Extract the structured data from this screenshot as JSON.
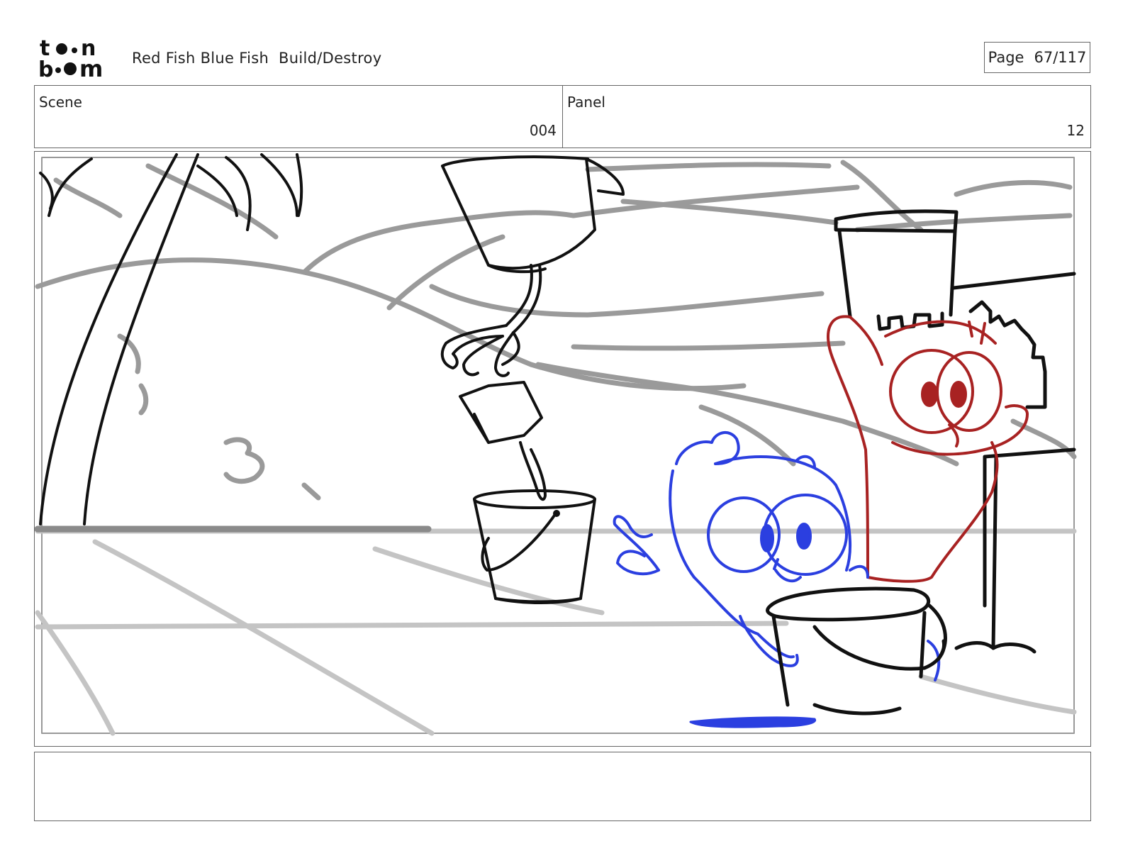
{
  "header": {
    "logo_text": "toon boom",
    "title": "Red Fish Blue Fish  Build/Destroy",
    "page_label": "Page",
    "page_value": "67/117"
  },
  "info": {
    "scene_label": "Scene",
    "scene_value": "004",
    "panel_label": "Panel",
    "panel_value": "12"
  },
  "sketch": {
    "description_icons": [
      "palm-tree",
      "hanging-bucket",
      "grabber-claw",
      "sand-bucket",
      "blue-fish",
      "red-fish",
      "sandcastle"
    ],
    "colors": {
      "line": "#111111",
      "rough": "#9a9a9a",
      "blue_fish": "#2b3fe0",
      "red_fish": "#a82222"
    }
  },
  "notes": {
    "text": ""
  }
}
